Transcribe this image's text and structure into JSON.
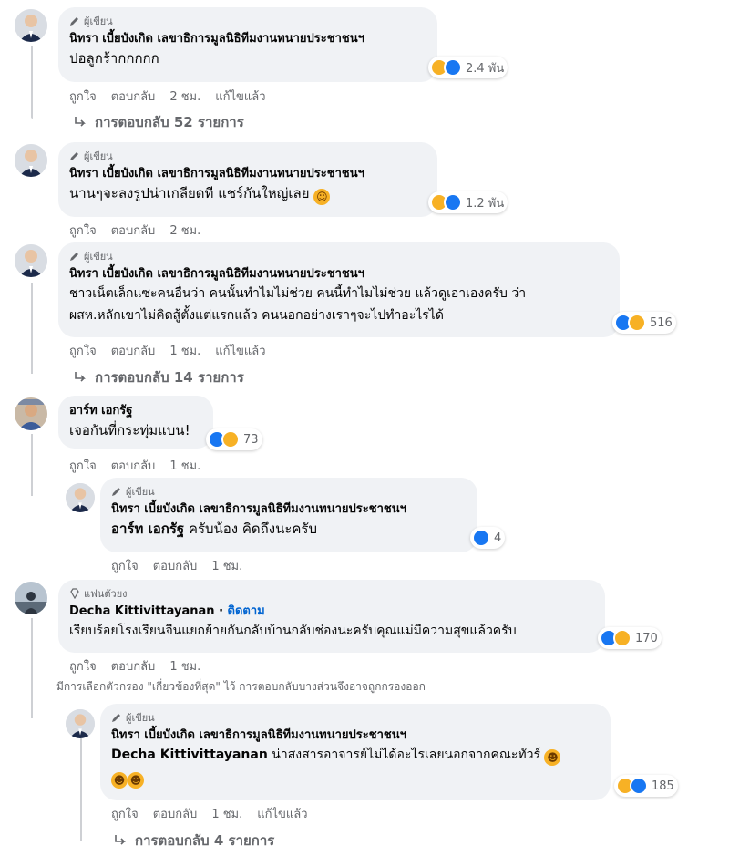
{
  "comments": [
    {
      "badge": "ผู้เขียน",
      "author": "นิทรา เบี้ยบังเกิด เลขาธิการมูลนิธิทีมงานทนายประชาชนฯ",
      "text": "ปอลูกร้ากกกกก",
      "reaction_count": "2.4 พัน",
      "like": "ถูกใจ",
      "reply": "ตอบกลับ",
      "time": "2 ชม.",
      "edited": "แก้ไขแล้ว",
      "replies_label": "การตอบกลับ 52 รายการ"
    },
    {
      "badge": "ผู้เขียน",
      "author": "นิทรา เบี้ยบังเกิด เลขาธิการมูลนิธิทีมงานทนายประชาชนฯ",
      "text": "นานๆจะลงรูปน่าเกลียดที แชร์กันใหญ่เลย",
      "reaction_count": "1.2 พัน",
      "like": "ถูกใจ",
      "reply": "ตอบกลับ",
      "time": "2 ชม."
    },
    {
      "badge": "ผู้เขียน",
      "author": "นิทรา เบี้ยบังเกิด เลขาธิการมูลนิธิทีมงานทนายประชาชนฯ",
      "text1": "ชาวเน็ตเล็กแซะคนอื่นว่า คนนั้นทำไมไม่ช่วย คนนี้ทำไมไม่ช่วย แล้วดูเอาเองครับ ว่า",
      "text2": "ผสห.หลักเขาไม่คิดสู้ตั้งแต่แรกแล้ว คนนอกอย่างเราๆจะไปทำอะไรได้",
      "reaction_count": "516",
      "like": "ถูกใจ",
      "reply": "ตอบกลับ",
      "time": "1 ชม.",
      "edited": "แก้ไขแล้ว",
      "replies_label": "การตอบกลับ 14 รายการ"
    },
    {
      "author": "อาร์ท เอกรัฐ",
      "text": "เจอกันที่กระทุ่มแบน!",
      "reaction_count": "73",
      "like": "ถูกใจ",
      "reply": "ตอบกลับ",
      "time": "1 ชม."
    },
    {
      "badge": "ผู้เขียน",
      "author": "นิทรา เบี้ยบังเกิด เลขาธิการมูลนิธิทีมงานทนายประชาชนฯ",
      "mention": "อาร์ท เอกรัฐ",
      "text": " ครับน้อง คิดถึงนะครับ",
      "reaction_count": "4",
      "like": "ถูกใจ",
      "reply": "ตอบกลับ",
      "time": "1 ชม."
    },
    {
      "badge": "แฟนตัวยง",
      "author": "Decha Kittivittayanan",
      "follow": "ติดตาม",
      "text": "เรียบร้อยโรงเรียนจีนแยกย้ายกันกลับบ้านกลับช่องนะครับคุณแม่มีความสุขแล้วครับ",
      "reaction_count": "170",
      "like": "ถูกใจ",
      "reply": "ตอบกลับ",
      "time": "1 ชม."
    },
    {
      "badge": "ผู้เขียน",
      "author": "นิทรา เบี้ยบังเกิด เลขาธิการมูลนิธิทีมงานทนายประชาชนฯ",
      "mention": "Decha Kittivittayanan",
      "text": " น่าสงสารอาจารย์ไม่ได้อะไรเลยนอกจากคณะทัวร์",
      "reaction_count": "185",
      "like": "ถูกใจ",
      "reply": "ตอบกลับ",
      "time": "1 ชม.",
      "edited": "แก้ไขแล้ว",
      "replies_label": "การตอบกลับ 4 รายการ"
    }
  ],
  "filter_note": "มีการเลือกตัวกรอง \"เกี่ยวข้องที่สุด\" ไว้ การตอบกลับบางส่วนจึงอาจถูกกรองออก",
  "colors": {
    "like_blue": "#1877f2",
    "haha_yellow": "#f7b125",
    "bubble": "#f0f2f5",
    "secondary_text": "#65676b",
    "link_blue": "#0064d1"
  }
}
